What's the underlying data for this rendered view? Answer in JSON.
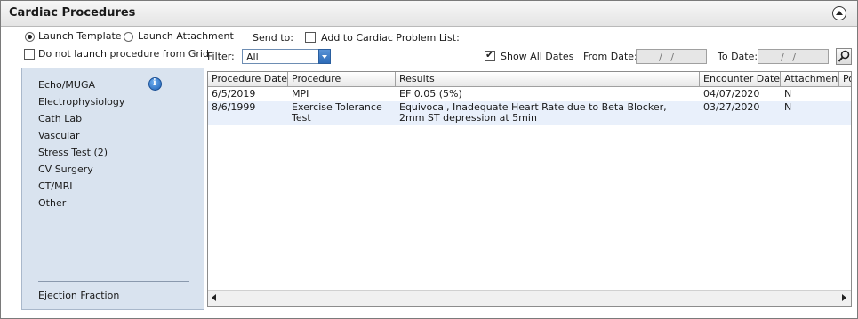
{
  "panel": {
    "title": "Cardiac Procedures"
  },
  "launch": {
    "template_label": "Launch Template",
    "attachment_label": "Launch Attachment",
    "selected": "template"
  },
  "send_to": {
    "label": "Send to:",
    "problem_list_label": "Add to Cardiac Problem List:",
    "problem_list_checked": false
  },
  "no_launch": {
    "label": "Do not launch procedure from Grid",
    "checked": false
  },
  "filter": {
    "label": "Filter:",
    "value": "All"
  },
  "dates": {
    "show_all_label": "Show All Dates",
    "show_all_checked": true,
    "from_label": "From Date:",
    "from_value": "/ /",
    "to_label": "To Date:",
    "to_value": "/ /"
  },
  "nav": {
    "items": [
      "Echo/MUGA",
      "Electrophysiology",
      "Cath Lab",
      "Vascular",
      "Stress Test (2)",
      "CV Surgery",
      "CT/MRI",
      "Other"
    ],
    "footer_item": "Ejection Fraction"
  },
  "table": {
    "columns": [
      "Procedure Date",
      "Procedure",
      "Results",
      "Encounter Date",
      "Attachment",
      "Po"
    ],
    "rows": [
      [
        "6/5/2019",
        "MPI",
        "EF 0.05 (5%)",
        "04/07/2020",
        "N"
      ],
      [
        "8/6/1999",
        "Exercise Tolerance Test",
        "Equivocal, Inadequate Heart Rate due to Beta Blocker, 2mm ST depression at 5min",
        "03/27/2020",
        "N"
      ]
    ]
  }
}
